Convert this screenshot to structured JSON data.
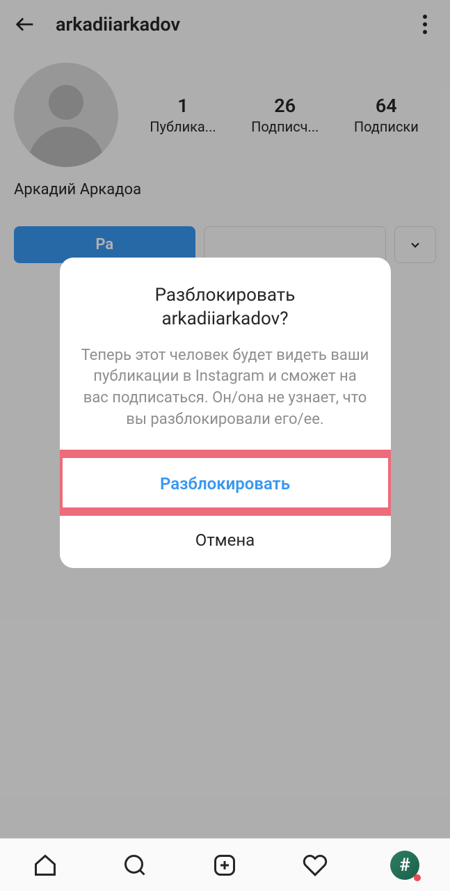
{
  "header": {
    "username": "arkadiiarkadov"
  },
  "profile": {
    "posts_count": "1",
    "posts_label": "Публика...",
    "followers_count": "26",
    "followers_label": "Подписч...",
    "following_count": "64",
    "following_label": "Подписки",
    "display_name": "Аркадий Аркадоа"
  },
  "actions": {
    "unblock_label": "Ра"
  },
  "dialog": {
    "title_line1": "Разблокировать",
    "title_line2": "arkadiiarkadov?",
    "description": "Теперь этот человек будет видеть ваши публикации в Instagram и сможет на вас подписаться. Он/она не узнает, что вы разблокировали его/ее.",
    "primary_button": "Разблокировать",
    "secondary_button": "Отмена"
  }
}
